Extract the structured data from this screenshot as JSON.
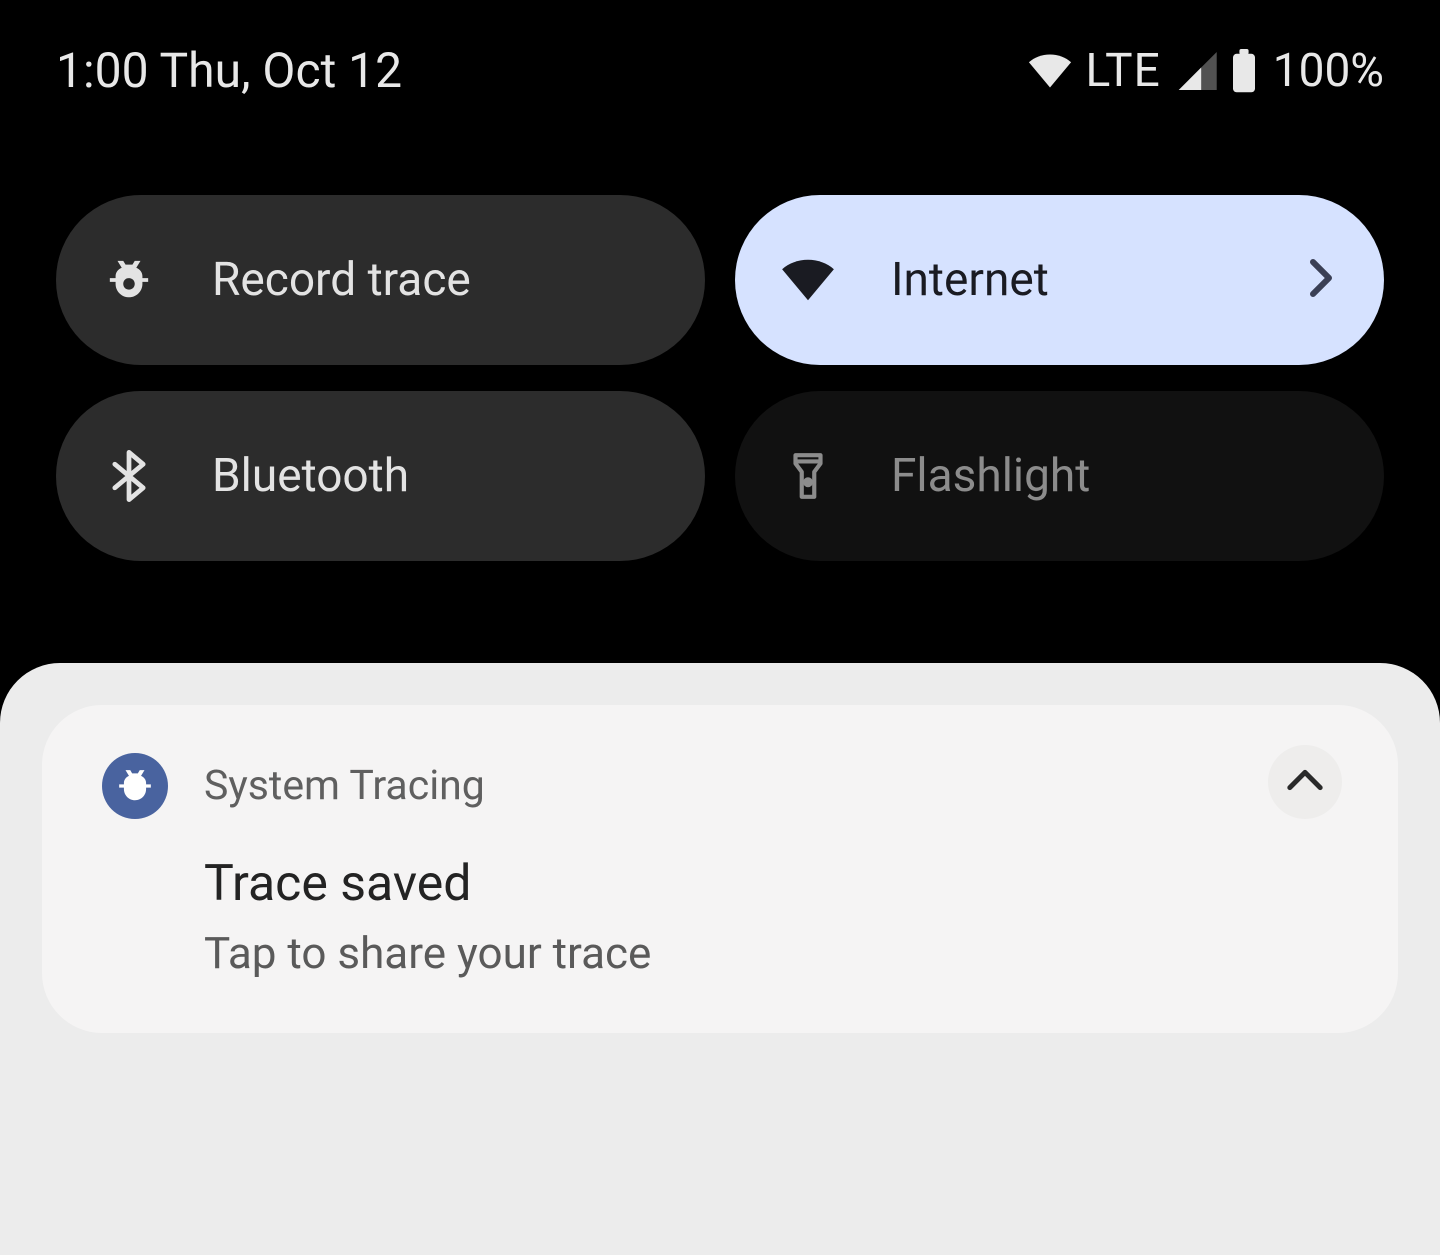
{
  "statusbar": {
    "clock": "1:00 Thu, Oct 12",
    "network_label": "LTE",
    "battery_pct": "100%"
  },
  "qs": {
    "tiles": [
      {
        "id": "record-trace",
        "label": "Record trace",
        "state": "off",
        "icon": "bug-icon"
      },
      {
        "id": "internet",
        "label": "Internet",
        "state": "on",
        "icon": "wifi-icon",
        "has_chevron": true
      },
      {
        "id": "bluetooth",
        "label": "Bluetooth",
        "state": "off",
        "icon": "bluetooth-icon"
      },
      {
        "id": "flashlight",
        "label": "Flashlight",
        "state": "disabled",
        "icon": "flashlight-icon"
      }
    ]
  },
  "notification": {
    "app_name": "System Tracing",
    "title": "Trace saved",
    "subtitle": "Tap to share your trace"
  }
}
